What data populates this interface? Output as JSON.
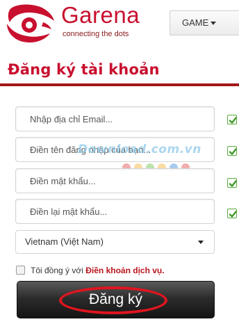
{
  "header": {
    "brand": "Garena",
    "tagline": "connecting the dots",
    "game_menu": "GAME"
  },
  "form": {
    "title": "Đăng ký tài khoản",
    "email_placeholder": "Nhập địa chỉ Email...",
    "username_placeholder": "Điền tên đăng nhập của bạn...",
    "password_placeholder": "Điền mật khẩu...",
    "confirm_password_placeholder": "Điền lại mật khẩu...",
    "country_selected": "Vietnam (Việt Nam)",
    "terms_prefix": "Tôi đồng ý với",
    "terms_link": "Điền khoản dịch vụ.",
    "register_label": "Đăng ký"
  },
  "watermark": "Download.com.vn",
  "colors": {
    "brand_red": "#c8102e",
    "check_green": "#5aaa3c",
    "button_dark": "#1c1c1c",
    "highlight_ring": "#e0151f"
  },
  "icons": {
    "logo": "garena-dragon-logo",
    "validation": "checkmark-icon",
    "dropdown": "caret-down-icon"
  }
}
